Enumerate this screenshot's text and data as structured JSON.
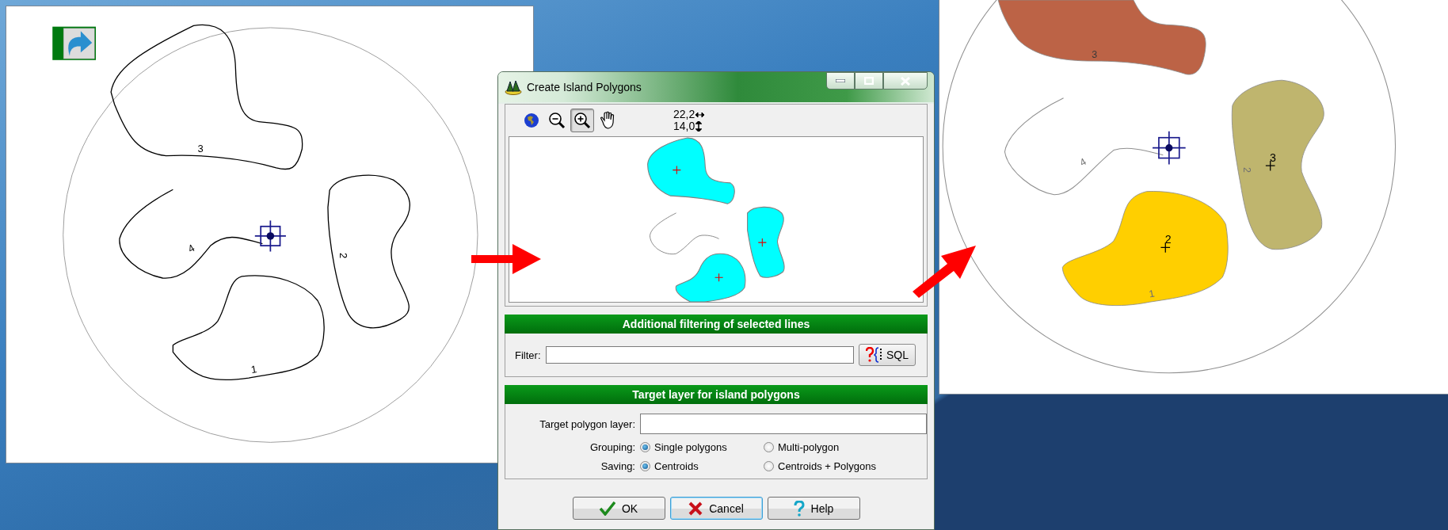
{
  "left_panel": {
    "map": {
      "labels": [
        "3",
        "4",
        "2",
        "1"
      ]
    }
  },
  "dialog": {
    "title": "Create Island Polygons",
    "tools": [
      {
        "kind": "globe",
        "selected": false
      },
      {
        "kind": "zoom_out",
        "selected": false
      },
      {
        "kind": "zoom_in",
        "selected": true
      },
      {
        "kind": "pan",
        "selected": false
      }
    ],
    "readouts": [
      {
        "kind": "horizontal",
        "text": "22,2"
      },
      {
        "kind": "vertical",
        "text": "14,0"
      }
    ],
    "filter_section": {
      "header": "Additional filtering of selected lines",
      "label": "Filter:",
      "button": "SQL"
    },
    "target_section": {
      "header": "Target layer for island polygons",
      "layer_label": "Target polygon layer:",
      "groups": [
        {
          "label": "Grouping:",
          "options": [
            {
              "label": "Single polygons",
              "selected": true
            },
            {
              "label": "Multi-polygon",
              "selected": false
            }
          ]
        },
        {
          "label": "Saving:",
          "options": [
            {
              "label": "Centroids",
              "selected": true
            },
            {
              "label": "Centroids + Polygons",
              "selected": false
            }
          ]
        }
      ]
    },
    "buttons": [
      {
        "kind": "ok",
        "label": "OK",
        "focused": false
      },
      {
        "kind": "cancel",
        "label": "Cancel",
        "focused": true
      },
      {
        "kind": "help",
        "label": "Help",
        "focused": false
      }
    ]
  },
  "right_panel": {
    "map": {
      "line_labels": [
        "3",
        "4",
        "2",
        "1"
      ],
      "polygons": [
        {
          "color": "#bc6346"
        },
        {
          "color": "#ffcf00",
          "label": "2"
        },
        {
          "color": "#bfb56e",
          "label": "3"
        }
      ]
    }
  }
}
